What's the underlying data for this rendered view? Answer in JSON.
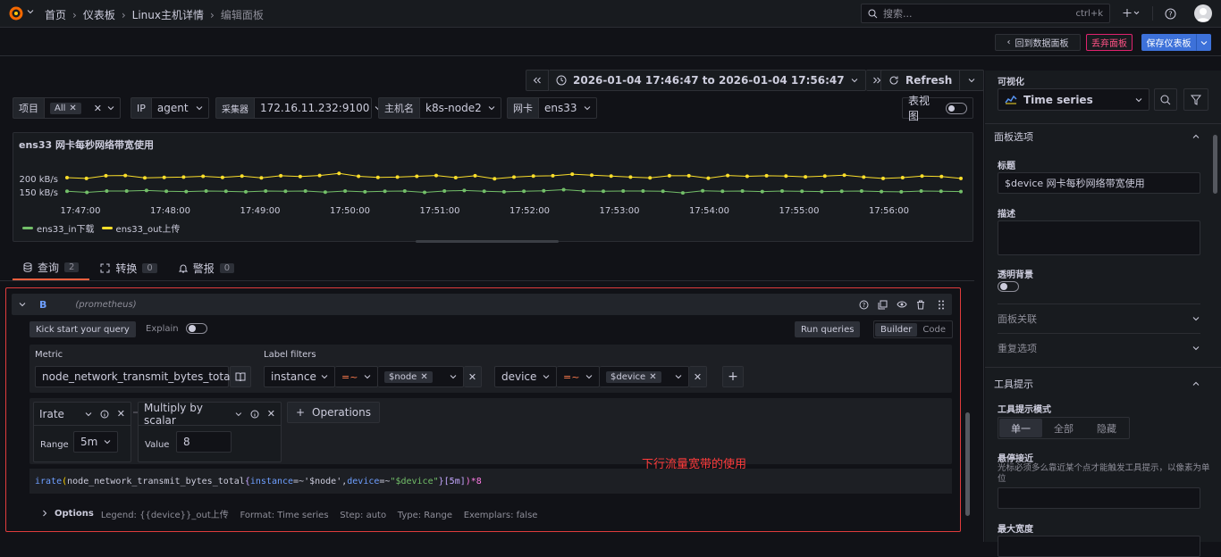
{
  "topbar": {
    "breadcrumbs": [
      "首页",
      "仪表板",
      "Linux主机详情",
      "编辑面板"
    ],
    "search_placeholder": "搜索...",
    "search_shortcut": "ctrl+k"
  },
  "toolbar2": {
    "back_label": "回到数据面板",
    "discard_label": "丢弃面板",
    "save_label": "保存仪表板"
  },
  "timepicker": {
    "range": "2026-01-04 17:46:47 to 2026-01-04 17:56:47",
    "refresh_label": "Refresh"
  },
  "variables": {
    "project_label": "项目",
    "project_value": "All",
    "ip_label": "IP",
    "ip_value": "agent",
    "collector_label": "采集器",
    "collector_value": "172.16.11.232:9100",
    "host_label": "主机名",
    "host_value": "k8s-node2",
    "nic_label": "网卡",
    "nic_value": "ens33",
    "table_view_label": "表视图"
  },
  "panel": {
    "title": "ens33 网卡每秒网络带宽使用",
    "legend": [
      "ens33_in下载",
      "ens33_out上传"
    ]
  },
  "chart_data": {
    "type": "line",
    "title": "ens33 网卡每秒网络带宽使用",
    "xlabel": "",
    "ylabel": "",
    "y_ticks": [
      "150 kB/s",
      "200 kB/s"
    ],
    "x_ticks": [
      "17:47:00",
      "17:48:00",
      "17:49:00",
      "17:50:00",
      "17:51:00",
      "17:52:00",
      "17:53:00",
      "17:54:00",
      "17:55:00",
      "17:56:00"
    ],
    "ylim": [
      100,
      250
    ],
    "series": [
      {
        "name": "ens33_in下载",
        "color": "#73bf69",
        "values": [
          149,
          145,
          150,
          150,
          152,
          149,
          148,
          150,
          149,
          147,
          150,
          149,
          150,
          146,
          150,
          147,
          149,
          150,
          145,
          150,
          152,
          149,
          147,
          149,
          151,
          155,
          150,
          149,
          150,
          150,
          149,
          143,
          151,
          149,
          150,
          148,
          150,
          149,
          148,
          149,
          150,
          148,
          147,
          150,
          149,
          148
        ]
      },
      {
        "name": "ens33_out上传",
        "color": "#fade2a",
        "values": [
          200,
          197,
          207,
          208,
          199,
          201,
          202,
          205,
          201,
          206,
          199,
          207,
          204,
          208,
          216,
          205,
          201,
          202,
          205,
          208,
          200,
          207,
          196,
          202,
          206,
          207,
          213,
          209,
          206,
          202,
          199,
          207,
          207,
          198,
          208,
          205,
          207,
          206,
          203,
          206,
          209,
          202,
          197,
          200,
          206,
          204,
          197
        ]
      }
    ]
  },
  "query_tabs": [
    {
      "label": "查询",
      "count": "2"
    },
    {
      "label": "转换",
      "count": "0"
    },
    {
      "label": "警报",
      "count": "0"
    }
  ],
  "query": {
    "ref_id": "B",
    "datasource": "(prometheus)",
    "kickstart_label": "Kick start your query",
    "explain_label": "Explain",
    "run_label": "Run queries",
    "builder_label": "Builder",
    "code_label": "Code",
    "metric_label": "Metric",
    "metric_value": "node_network_transmit_bytes_total",
    "label_filters_label": "Label filters",
    "filter1": {
      "key": "instance",
      "op": "=~",
      "value": "$node"
    },
    "filter2": {
      "key": "device",
      "op": "=~",
      "value": "$device"
    },
    "op1": {
      "name": "Irate",
      "param_label": "Range",
      "param_value": "5m"
    },
    "op2": {
      "name": "Multiply by scalar",
      "param_label": "Value",
      "param_value": "8"
    },
    "operations_label": "Operations",
    "annotation": "下行流量宽带的使用",
    "promql": {
      "fn": "irate",
      "metric": "node_network_transmit_bytes_total",
      "l1": "instance",
      "op": "=~",
      "v1": "'$node'",
      "l2": "device",
      "v2": "\"$device\"",
      "range": "[5m]",
      "suffix": ")*8"
    },
    "options_label": "Options",
    "options_summary": "Legend: {{device}}_out上传    Format: Time series    Step: auto    Type: Range    Exemplars: false"
  },
  "right": {
    "viz_label": "可视化",
    "viz_value": "Time series",
    "panel_options": "面板选项",
    "title_label": "标题",
    "title_value": "$device 网卡每秒网络带宽使用",
    "desc_label": "描述",
    "transparent_label": "透明背景",
    "links_label": "面板关联",
    "repeat_label": "重复选项",
    "tooltip_section": "工具提示",
    "tooltip_mode_label": "工具提示模式",
    "mode_single": "单一",
    "mode_all": "全部",
    "mode_hidden": "隐藏",
    "hover_label": "悬停接近",
    "hover_desc": "光标必须多么靠近某个点才能触发工具提示，以像素为单位",
    "max_width_label": "最大宽度"
  }
}
